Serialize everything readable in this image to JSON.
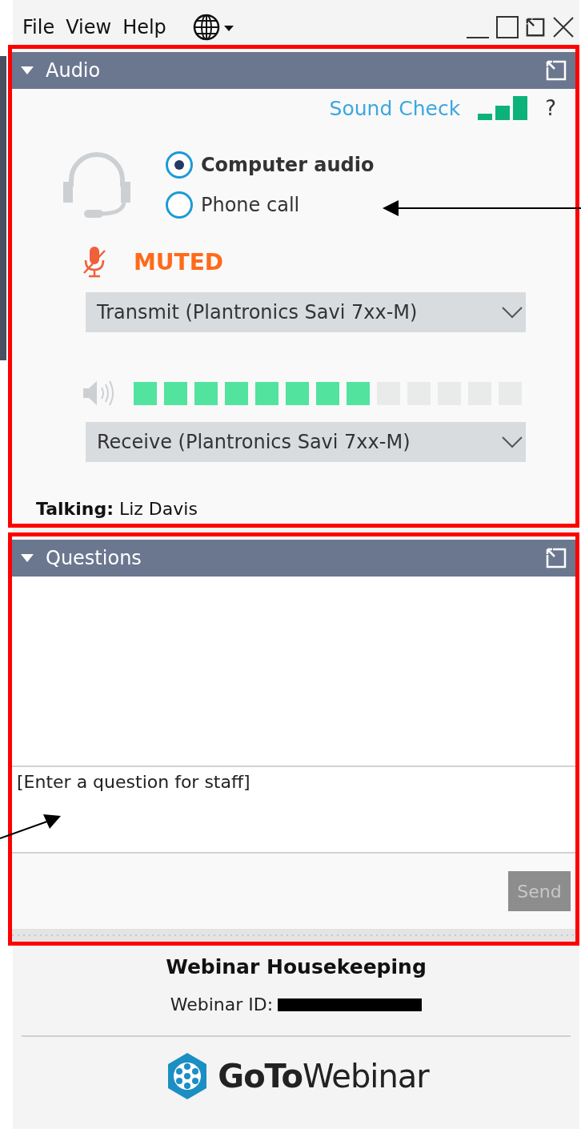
{
  "menu": [
    "File",
    "View",
    "Help"
  ],
  "audio": {
    "title": "Audio",
    "expanded": true,
    "sound_check": "Sound Check",
    "help": "?",
    "options": [
      {
        "label": "Computer audio",
        "selected": true
      },
      {
        "label": "Phone call",
        "selected": false
      }
    ],
    "mic_status": "MUTED",
    "transmit": "Transmit (Plantronics Savi 7xx-M)",
    "speaker": {
      "level": 0.615
    },
    "receive": "Receive (Plantronics Savi 7xx-M)",
    "talking_label": "Talking:",
    "talking_name": "Liz Davis"
  },
  "questions": {
    "title": "Questions",
    "expanded": true,
    "placeholder": "[Enter a question for staff]",
    "send": {
      "label": "Send",
      "disabled": true
    }
  },
  "footer": {
    "title": "Webinar Housekeeping",
    "id_label": "Webinar ID:",
    "brand_bold": "GoTo",
    "brand_light": "Webinar"
  }
}
